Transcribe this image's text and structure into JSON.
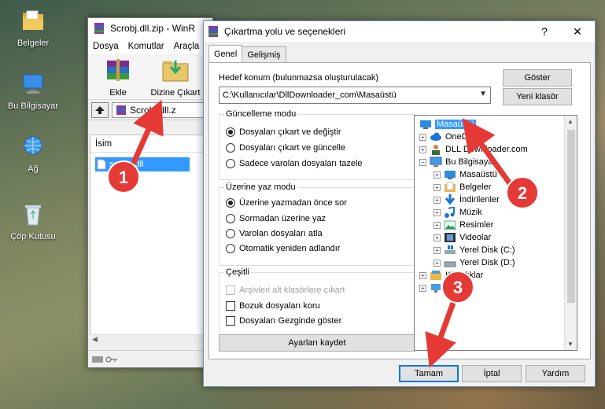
{
  "desktop": {
    "icons": [
      {
        "label": "Belgeler",
        "icon": "folder-documents-icon"
      },
      {
        "label": "Bu Bilgisayar",
        "icon": "computer-icon"
      },
      {
        "label": "Ağ",
        "icon": "network-icon"
      },
      {
        "label": "Çöp Kutusu",
        "icon": "recycle-bin-icon"
      }
    ]
  },
  "winrar": {
    "title": "Scrobj.dll.zip - WinR",
    "menu": [
      "Dosya",
      "Komutlar",
      "Araçla"
    ],
    "toolbar": {
      "extract_label": "Ekle",
      "extract_to_label": "Dizine Çıkart"
    },
    "path_text": "Scrobj.dll.z",
    "list_header": "İsim",
    "file_name": "scrobj.dll"
  },
  "dialog": {
    "title": "Çıkartma yolu ve seçenekleri",
    "help_glyph": "?",
    "close_glyph": "✕",
    "tabs": [
      "Genel",
      "Gelişmiş"
    ],
    "dest_label": "Hedef konum (bulunmazsa oluşturulacak)",
    "dest_value": "C:\\Kullanıcılar\\DllDownloader_com\\Masaüstü",
    "show_button": "Göster",
    "new_folder_button": "Yeni klasör",
    "update_group": {
      "title": "Güncelleme modu",
      "options": [
        "Dosyaları çıkart ve değiştir",
        "Dosyaları çıkart ve güncelle",
        "Sadece varolan dosyaları tazele"
      ],
      "selected": 0
    },
    "overwrite_group": {
      "title": "Üzerine yaz modu",
      "options": [
        "Üzerine yazmadan önce sor",
        "Sormadan üzerine yaz",
        "Varolan dosyaları atla",
        "Otomatik yeniden adlandır"
      ],
      "selected": 0
    },
    "misc_group": {
      "title": "Çeşitli",
      "options": [
        "Arşivleri alt klasörlere çıkart",
        "Bozuk dosyaları koru",
        "Dosyaları Gezginde göster"
      ]
    },
    "save_settings_button": "Ayarları kaydet",
    "tree": {
      "root": "Masaüstü",
      "level1": [
        "OneDrive",
        "DLL Downloader.com",
        "Bu Bilgisayar"
      ],
      "computer_children": [
        "Masaüstü",
        "Belgeler",
        "İndirilenler",
        "Müzik",
        "Resimler",
        "Videolar",
        "Yerel Disk (C:)",
        "Yerel Disk (D:)"
      ],
      "after": [
        "Kitaplıklar"
      ]
    },
    "ok_button": "Tamam",
    "cancel_button": "İptal",
    "help_button": "Yardım"
  },
  "annotations": [
    "1",
    "2",
    "3"
  ],
  "colors": {
    "annotation_red": "#e53935",
    "selection_blue": "#3399ff"
  }
}
